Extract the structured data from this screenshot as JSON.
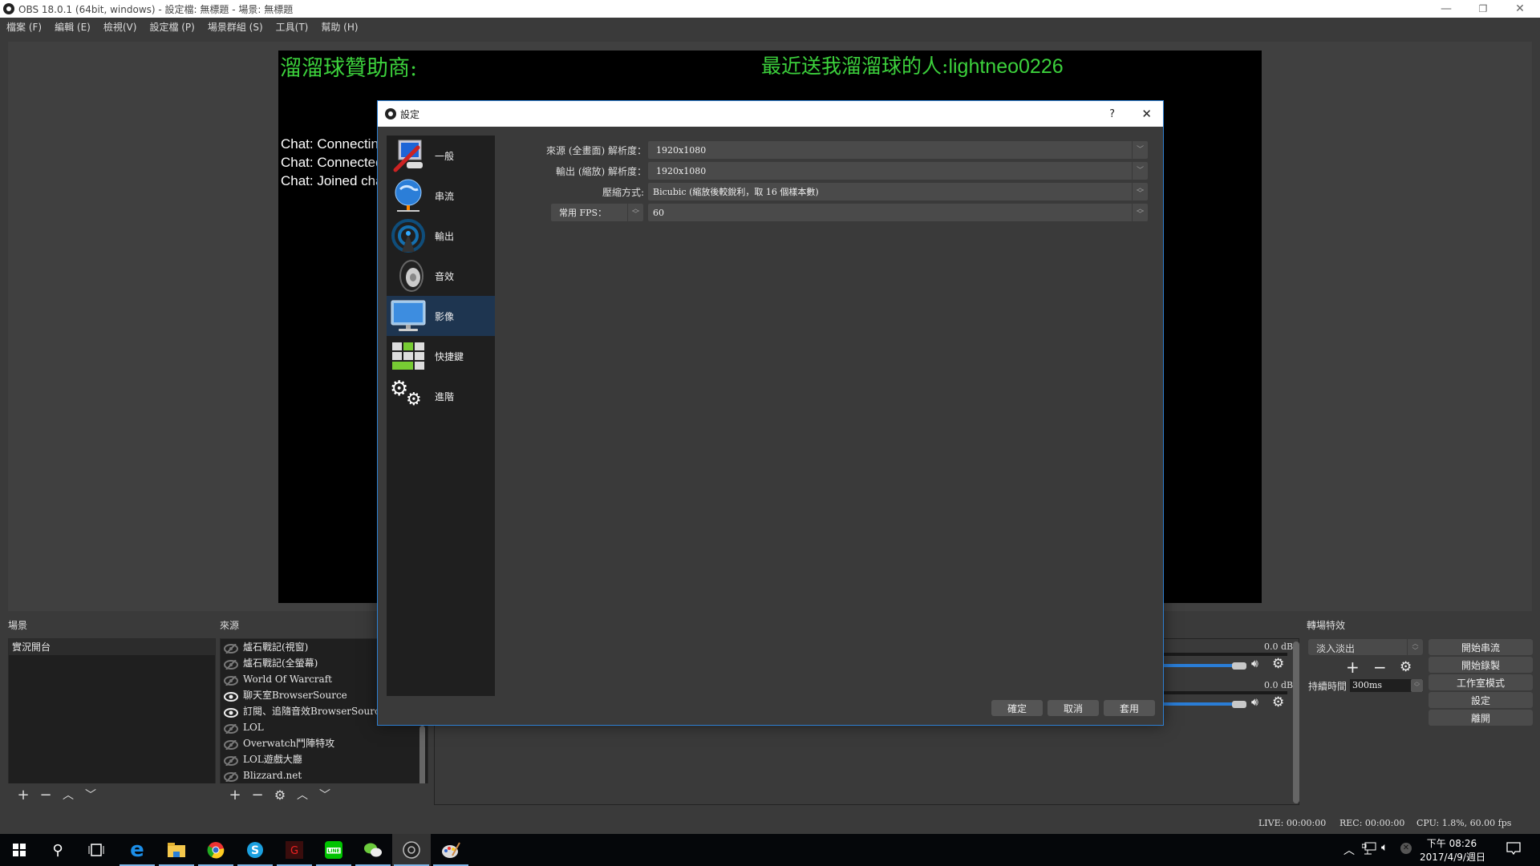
{
  "window": {
    "title": "OBS 18.0.1 (64bit, windows) - 設定檔: 無標題 - 場景: 無標題",
    "controls": {
      "minimize": "—",
      "maximize": "❐",
      "close": "✕"
    }
  },
  "menu": [
    "檔案 (F)",
    "編輯 (E)",
    "檢視(V)",
    "設定檔 (P)",
    "場景群組 (S)",
    "工具(T)",
    "幫助 (H)"
  ],
  "preview": {
    "sponsor_text": "溜溜球贊助商:",
    "recent_label": "最近送我溜溜球的人:",
    "recent_name": "lightneo0226",
    "chat_lines": [
      "Chat: Connecting...",
      "Chat: Connected.",
      "Chat: Joined channel"
    ]
  },
  "settings_dialog": {
    "title": "設定",
    "help": "?",
    "close": "✕",
    "sidebar": [
      {
        "label": "一般",
        "icon": "general-icon"
      },
      {
        "label": "串流",
        "icon": "stream-globe-icon"
      },
      {
        "label": "輸出",
        "icon": "output-antenna-icon"
      },
      {
        "label": "音效",
        "icon": "audio-speaker-icon"
      },
      {
        "label": "影像",
        "icon": "video-monitor-icon",
        "selected": true
      },
      {
        "label": "快捷鍵",
        "icon": "hotkeys-keyboard-icon"
      },
      {
        "label": "進階",
        "icon": "advanced-gears-icon"
      }
    ],
    "video": {
      "base_resolution_label": "來源 (全畫面) 解析度：",
      "base_resolution": "1920x1080",
      "output_resolution_label": "輸出 (縮放) 解析度：",
      "output_resolution": "1920x1080",
      "downscale_filter_label": "壓縮方式:",
      "downscale_filter": "Bicubic (縮放後較銳利，取 16 個樣本數)",
      "fps_type": "常用 FPS：",
      "fps_value": "60"
    },
    "buttons": {
      "ok": "確定",
      "cancel": "取消",
      "apply": "套用"
    }
  },
  "scenes": {
    "title": "場景",
    "items": [
      "實況開台"
    ]
  },
  "sources": {
    "title": "來源",
    "items": [
      {
        "name": "爐石戰記(視窗)",
        "visible": false
      },
      {
        "name": "爐石戰記(全螢幕)",
        "visible": false
      },
      {
        "name": "World Of Warcraft",
        "visible": false
      },
      {
        "name": "聊天室BrowserSource",
        "visible": true
      },
      {
        "name": "訂閱、追隨音效BrowserSource",
        "visible": true
      },
      {
        "name": "LOL",
        "visible": false
      },
      {
        "name": "Overwatch鬥陣特攻",
        "visible": false
      },
      {
        "name": "LOL遊戲大廳",
        "visible": false
      },
      {
        "name": "Blizzard.net",
        "visible": false
      }
    ]
  },
  "mixer": {
    "channels": [
      {
        "db": "0.0 dB",
        "volume_fraction": 1.0
      },
      {
        "db": "0.0 dB",
        "volume_fraction": 1.0
      }
    ]
  },
  "transitions": {
    "title": "轉場特效",
    "selected": "淡入淡出",
    "duration_label": "持續時間",
    "duration_value": "300ms"
  },
  "controls": [
    "開始串流",
    "開始錄製",
    "工作室模式",
    "設定",
    "離開"
  ],
  "statusbar": {
    "live": "LIVE: 00:00:00",
    "rec": "REC: 00:00:00",
    "cpu": "CPU: 1.8%, 60.00 fps"
  },
  "taskbar": {
    "time": "下午 08:26",
    "date": "2017/4/9/週日"
  }
}
